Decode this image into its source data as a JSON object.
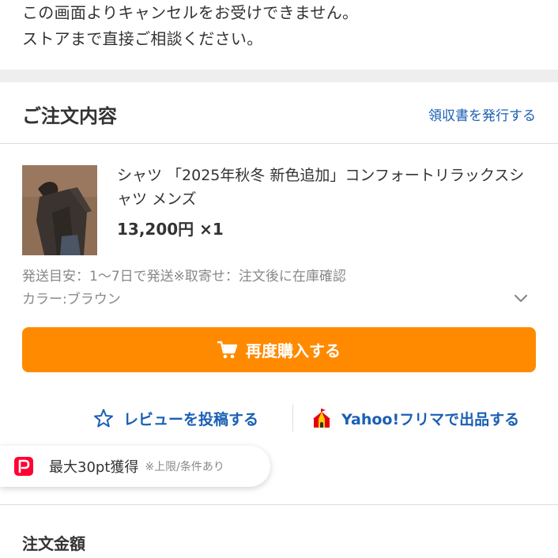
{
  "notice": {
    "line1": "この画面よりキャンセルをお受けできません。",
    "line2": "ストアまで直接ご相談ください。"
  },
  "order": {
    "title": "ご注文内容",
    "receipt_link": "領収書を発行する"
  },
  "product": {
    "name": "シャツ 「2025年秋冬 新色追加」コンフォートリラックスシャツ メンズ",
    "price": "13,200円 ×1",
    "shipping": "発送目安：1〜7日で発送※取寄せ：注文後に在庫確認",
    "color": "カラー:ブラウン",
    "image_icon": "product-photo-brown-shirt"
  },
  "buttons": {
    "rebuy": "再度購入する",
    "review": "レビューを投稿する",
    "flea": "Yahoo!フリマで出品する"
  },
  "points": {
    "text": "最大30pt獲得",
    "note": "※上限/条件あり"
  },
  "total": {
    "title": "注文金額"
  },
  "colors": {
    "accent_orange": "#ff8a00",
    "link_blue": "#1a5fb4",
    "paypay_red": "#ff0033",
    "flea_red": "#e60012",
    "flea_yellow": "#ffcc00"
  }
}
